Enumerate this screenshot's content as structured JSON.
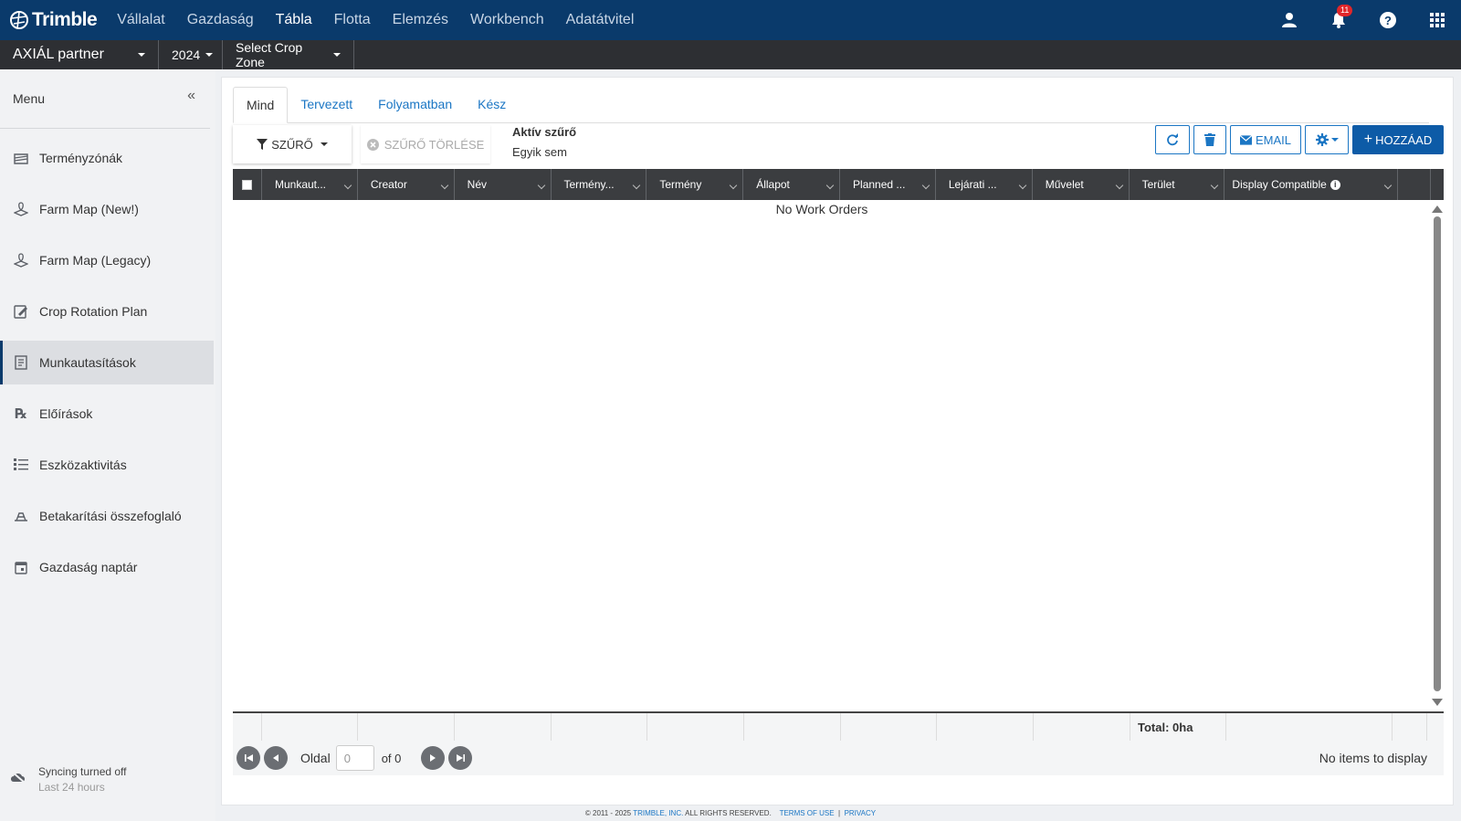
{
  "brand": {
    "name": "Trimble"
  },
  "topnav": {
    "items": [
      {
        "label": "Vállalat"
      },
      {
        "label": "Gazdaság"
      },
      {
        "label": "Tábla"
      },
      {
        "label": "Flotta"
      },
      {
        "label": "Elemzés"
      },
      {
        "label": "Workbench"
      },
      {
        "label": "Adatátvitel"
      }
    ],
    "active": "Tábla",
    "notification_count": "11"
  },
  "subbar": {
    "organization": "AXIÁL partner",
    "year": "2024",
    "crop_zone": "Select Crop Zone"
  },
  "sidebar": {
    "title": "Menu",
    "items": [
      {
        "label": "Terményzónák",
        "icon": "crop-zone-icon"
      },
      {
        "label": "Farm Map (New!)",
        "icon": "farm-map-icon"
      },
      {
        "label": "Farm Map (Legacy)",
        "icon": "farm-map-legacy-icon"
      },
      {
        "label": "Crop Rotation Plan",
        "icon": "crop-rotation-icon"
      },
      {
        "label": "Munkautasítások",
        "icon": "work-orders-icon"
      },
      {
        "label": "Előírások",
        "icon": "prescription-icon"
      },
      {
        "label": "Eszközaktivitás",
        "icon": "list-icon"
      },
      {
        "label": "Betakarítási összefoglaló",
        "icon": "harvest-icon"
      },
      {
        "label": "Gazdaság naptár",
        "icon": "calendar-icon"
      }
    ],
    "active_index": 4,
    "sync": {
      "status": "Syncing turned off",
      "period": "Last 24 hours"
    }
  },
  "tabs": [
    {
      "label": "Mind"
    },
    {
      "label": "Tervezett"
    },
    {
      "label": "Folyamatban"
    },
    {
      "label": "Kész"
    }
  ],
  "toolbar": {
    "filter_label": "SZŰRŐ",
    "clear_filter_label": "SZŰRŐ TÖRLÉSE",
    "active_filter_title": "Aktív szűrő",
    "active_filter_value": "Egyik sem",
    "email_label": "EMAIL",
    "add_label": "HOZZÁAD"
  },
  "grid": {
    "columns": [
      "Munkaut...",
      "Creator",
      "Név",
      "Termény...",
      "Termény",
      "Állapot",
      "Planned ...",
      "Lejárati ...",
      "Művelet",
      "Terület",
      "Display Compatible"
    ],
    "empty_message": "No Work Orders",
    "total": "Total: 0ha"
  },
  "pager": {
    "page_label": "Oldal",
    "page_value": "0",
    "of_label": "of 0",
    "status": "No items to display"
  },
  "footer": {
    "copyright": "© 2011 - 2025",
    "company": "TRIMBLE, INC.",
    "rights": "ALL RIGHTS RESERVED.",
    "terms": "TERMS OF USE",
    "sep": "|",
    "privacy": "PRIVACY"
  },
  "colors": {
    "topbar": "#0a3a6b",
    "subbar": "#2d2f33",
    "link": "#1b76c4",
    "primary_button": "#0d5ba7"
  }
}
